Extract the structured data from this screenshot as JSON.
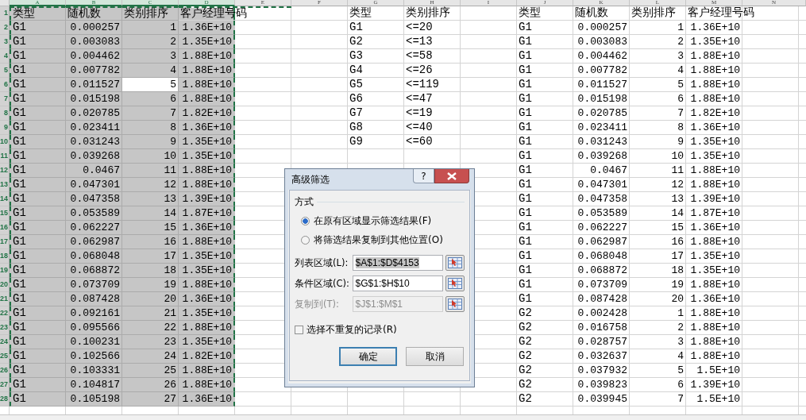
{
  "sheet": {
    "columns": [
      {
        "label": "A",
        "selected": true
      },
      {
        "label": "B",
        "selected": true
      },
      {
        "label": "C",
        "selected": true
      },
      {
        "label": "D",
        "selected": true
      },
      {
        "label": "E",
        "selected": false
      },
      {
        "label": "F",
        "selected": false
      },
      {
        "label": "G",
        "selected": false
      },
      {
        "label": "H",
        "selected": false
      },
      {
        "label": "I",
        "selected": false
      },
      {
        "label": "J",
        "selected": false
      },
      {
        "label": "K",
        "selected": false
      },
      {
        "label": "L",
        "selected": false
      },
      {
        "label": "M",
        "selected": false
      },
      {
        "label": "N",
        "selected": false
      }
    ],
    "row_numbers": [
      {
        "label": "1",
        "selected": true
      },
      {
        "label": "2",
        "selected": true
      },
      {
        "label": "3",
        "selected": true
      },
      {
        "label": "4",
        "selected": true
      },
      {
        "label": "5",
        "selected": true
      },
      {
        "label": "6",
        "selected": true
      },
      {
        "label": "7",
        "selected": true
      },
      {
        "label": "8",
        "selected": true
      },
      {
        "label": "9",
        "selected": true
      },
      {
        "label": "10",
        "selected": true
      },
      {
        "label": "11",
        "selected": true
      },
      {
        "label": "12",
        "selected": true
      },
      {
        "label": "13",
        "selected": true
      },
      {
        "label": "14",
        "selected": true
      },
      {
        "label": "15",
        "selected": true
      },
      {
        "label": "16",
        "selected": true
      },
      {
        "label": "17",
        "selected": true
      },
      {
        "label": "18",
        "selected": true
      },
      {
        "label": "19",
        "selected": true
      },
      {
        "label": "20",
        "selected": true
      },
      {
        "label": "21",
        "selected": true
      },
      {
        "label": "22",
        "selected": true
      },
      {
        "label": "23",
        "selected": true
      },
      {
        "label": "24",
        "selected": true
      },
      {
        "label": "25",
        "selected": true
      },
      {
        "label": "26",
        "selected": true
      },
      {
        "label": "27",
        "selected": true
      },
      {
        "label": "28",
        "selected": true
      }
    ],
    "list_table": {
      "selected": true,
      "headers": [
        "类型",
        "随机数",
        "类别排序",
        "客户经理号码"
      ],
      "rows": [
        {
          "type": "G1",
          "random": "0.000257",
          "rank": "1",
          "manager": "1.36E+10",
          "rank_active": false
        },
        {
          "type": "G1",
          "random": "0.003083",
          "rank": "2",
          "manager": "1.35E+10",
          "rank_active": false
        },
        {
          "type": "G1",
          "random": "0.004462",
          "rank": "3",
          "manager": "1.88E+10",
          "rank_active": false
        },
        {
          "type": "G1",
          "random": "0.007782",
          "rank": "4",
          "manager": "1.88E+10",
          "rank_active": false
        },
        {
          "type": "G1",
          "random": "0.011527",
          "rank": "5",
          "manager": "1.88E+10",
          "rank_active": true
        },
        {
          "type": "G1",
          "random": "0.015198",
          "rank": "6",
          "manager": "1.88E+10",
          "rank_active": false
        },
        {
          "type": "G1",
          "random": "0.020785",
          "rank": "7",
          "manager": "1.82E+10",
          "rank_active": false
        },
        {
          "type": "G1",
          "random": "0.023411",
          "rank": "8",
          "manager": "1.36E+10",
          "rank_active": false
        },
        {
          "type": "G1",
          "random": "0.031243",
          "rank": "9",
          "manager": "1.35E+10",
          "rank_active": false
        },
        {
          "type": "G1",
          "random": "0.039268",
          "rank": "10",
          "manager": "1.35E+10",
          "rank_active": false
        },
        {
          "type": "G1",
          "random": "0.0467",
          "rank": "11",
          "manager": "1.88E+10",
          "rank_active": false
        },
        {
          "type": "G1",
          "random": "0.047301",
          "rank": "12",
          "manager": "1.88E+10",
          "rank_active": false
        },
        {
          "type": "G1",
          "random": "0.047358",
          "rank": "13",
          "manager": "1.39E+10",
          "rank_active": false
        },
        {
          "type": "G1",
          "random": "0.053589",
          "rank": "14",
          "manager": "1.87E+10",
          "rank_active": false
        },
        {
          "type": "G1",
          "random": "0.062227",
          "rank": "15",
          "manager": "1.36E+10",
          "rank_active": false
        },
        {
          "type": "G1",
          "random": "0.062987",
          "rank": "16",
          "manager": "1.88E+10",
          "rank_active": false
        },
        {
          "type": "G1",
          "random": "0.068048",
          "rank": "17",
          "manager": "1.35E+10",
          "rank_active": false
        },
        {
          "type": "G1",
          "random": "0.068872",
          "rank": "18",
          "manager": "1.35E+10",
          "rank_active": false
        },
        {
          "type": "G1",
          "random": "0.073709",
          "rank": "19",
          "manager": "1.88E+10",
          "rank_active": false
        },
        {
          "type": "G1",
          "random": "0.087428",
          "rank": "20",
          "manager": "1.36E+10",
          "rank_active": false
        },
        {
          "type": "G1",
          "random": "0.092161",
          "rank": "21",
          "manager": "1.35E+10",
          "rank_active": false
        },
        {
          "type": "G1",
          "random": "0.095566",
          "rank": "22",
          "manager": "1.88E+10",
          "rank_active": false
        },
        {
          "type": "G1",
          "random": "0.100231",
          "rank": "23",
          "manager": "1.35E+10",
          "rank_active": false
        },
        {
          "type": "G1",
          "random": "0.102566",
          "rank": "24",
          "manager": "1.82E+10",
          "rank_active": false
        },
        {
          "type": "G1",
          "random": "0.103331",
          "rank": "25",
          "manager": "1.88E+10",
          "rank_active": false
        },
        {
          "type": "G1",
          "random": "0.104817",
          "rank": "26",
          "manager": "1.88E+10",
          "rank_active": false
        },
        {
          "type": "G1",
          "random": "0.105198",
          "rank": "27",
          "manager": "1.36E+10",
          "rank_active": false
        }
      ]
    },
    "criteria_table": {
      "headers": [
        "类型",
        "类别排序"
      ],
      "rows": [
        [
          "G1",
          "<=20"
        ],
        [
          "G2",
          "<=13"
        ],
        [
          "G3",
          "<=58"
        ],
        [
          "G4",
          "<=26"
        ],
        [
          "G5",
          "<=119"
        ],
        [
          "G6",
          "<=47"
        ],
        [
          "G7",
          "<=19"
        ],
        [
          "G8",
          "<=40"
        ],
        [
          "G9",
          "<=60"
        ]
      ]
    },
    "result_table": {
      "headers": [
        "类型",
        "随机数",
        "类别排序",
        "客户经理号码"
      ],
      "rows": [
        [
          "G1",
          "0.000257",
          "1",
          "1.36E+10"
        ],
        [
          "G1",
          "0.003083",
          "2",
          "1.35E+10"
        ],
        [
          "G1",
          "0.004462",
          "3",
          "1.88E+10"
        ],
        [
          "G1",
          "0.007782",
          "4",
          "1.88E+10"
        ],
        [
          "G1",
          "0.011527",
          "5",
          "1.88E+10"
        ],
        [
          "G1",
          "0.015198",
          "6",
          "1.88E+10"
        ],
        [
          "G1",
          "0.020785",
          "7",
          "1.82E+10"
        ],
        [
          "G1",
          "0.023411",
          "8",
          "1.36E+10"
        ],
        [
          "G1",
          "0.031243",
          "9",
          "1.35E+10"
        ],
        [
          "G1",
          "0.039268",
          "10",
          "1.35E+10"
        ],
        [
          "G1",
          "0.0467",
          "11",
          "1.88E+10"
        ],
        [
          "G1",
          "0.047301",
          "12",
          "1.88E+10"
        ],
        [
          "G1",
          "0.047358",
          "13",
          "1.39E+10"
        ],
        [
          "G1",
          "0.053589",
          "14",
          "1.87E+10"
        ],
        [
          "G1",
          "0.062227",
          "15",
          "1.36E+10"
        ],
        [
          "G1",
          "0.062987",
          "16",
          "1.88E+10"
        ],
        [
          "G1",
          "0.068048",
          "17",
          "1.35E+10"
        ],
        [
          "G1",
          "0.068872",
          "18",
          "1.35E+10"
        ],
        [
          "G1",
          "0.073709",
          "19",
          "1.88E+10"
        ],
        [
          "G1",
          "0.087428",
          "20",
          "1.36E+10"
        ],
        [
          "G2",
          "0.002428",
          "1",
          "1.88E+10"
        ],
        [
          "G2",
          "0.016758",
          "2",
          "1.88E+10"
        ],
        [
          "G2",
          "0.028757",
          "3",
          "1.88E+10"
        ],
        [
          "G2",
          "0.032637",
          "4",
          "1.88E+10"
        ],
        [
          "G2",
          "0.037932",
          "5",
          "1.5E+10"
        ],
        [
          "G2",
          "0.039823",
          "6",
          "1.39E+10"
        ],
        [
          "G2",
          "0.039945",
          "7",
          "1.5E+10"
        ]
      ]
    }
  },
  "dialog": {
    "title": "高级筛选",
    "help_button": "?",
    "group": "方式",
    "options": [
      {
        "label": "在原有区域显示筛选结果(F)",
        "selected": true
      },
      {
        "label": "将筛选结果复制到其他位置(O)",
        "selected": false
      }
    ],
    "fields": [
      {
        "label": "列表区域(L):",
        "value": "$A$1:$D$4153",
        "disabled": false,
        "highlighted": true
      },
      {
        "label": "条件区域(C):",
        "value": "$G$1:$H$10",
        "disabled": false,
        "highlighted": false
      },
      {
        "label": "复制到(T):",
        "value": "$J$1:$M$1",
        "disabled": true,
        "highlighted": false
      }
    ],
    "unique_checkbox": {
      "label": "选择不重复的记录(R)",
      "checked": false
    },
    "buttons": [
      {
        "label": "确定",
        "default": true
      },
      {
        "label": "取消",
        "default": false
      }
    ]
  }
}
